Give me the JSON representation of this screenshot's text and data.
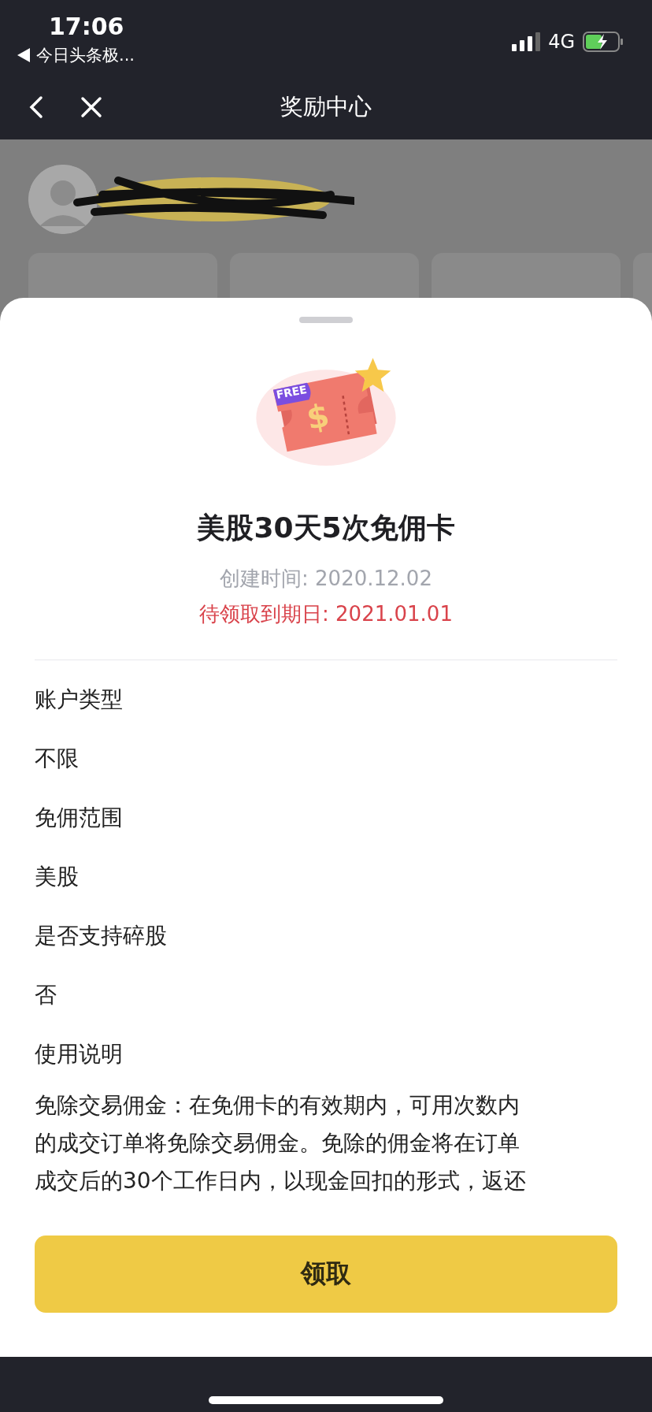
{
  "status_bar": {
    "time": "17:06",
    "back_app": "今日头条极...",
    "network": "4G"
  },
  "nav": {
    "title": "奖励中心"
  },
  "sheet": {
    "icon_badge": "FREE",
    "icon_symbol": "$",
    "title": "美股30天5次免佣卡",
    "created": "创建时间: 2020.12.02",
    "deadline": "待领取到期日: 2021.01.01",
    "details": [
      {
        "label": "账户类型",
        "value": "不限"
      },
      {
        "label": "免佣范围",
        "value": "美股"
      },
      {
        "label": "是否支持碎股",
        "value": "否"
      }
    ],
    "usage_title": "使用说明",
    "usage_text": "免除交易佣金：在免佣卡的有效期内，可用次数内的成交订单将免除交易佣金。免除的佣金将在订单成交后的30个工作日内，以现金回扣的形式，返还",
    "button": "领取"
  }
}
